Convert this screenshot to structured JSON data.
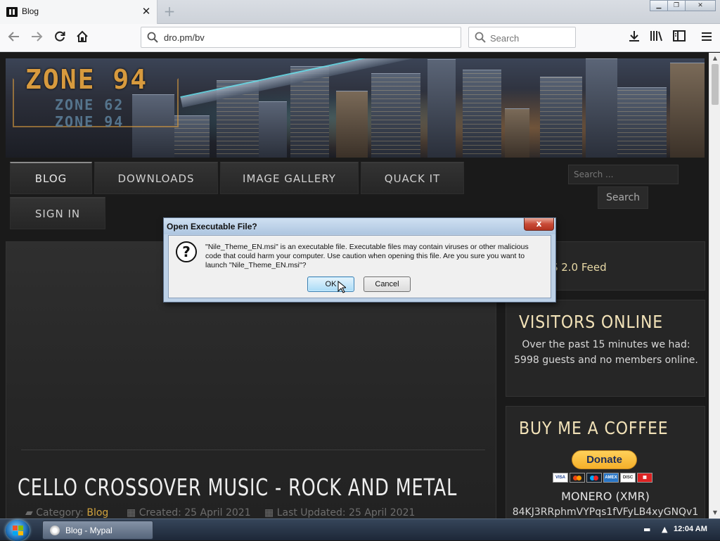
{
  "browser": {
    "tab_title": "Blog",
    "tab_close": "✕",
    "new_tab": "+",
    "url": "dro.pm/bv",
    "search_placeholder": "Search"
  },
  "site": {
    "logo_main": "ZONE 94",
    "logo_sub1": "ZONE 62",
    "logo_sub2": "ZONE 94",
    "menu": [
      "BLOG",
      "DOWNLOADS",
      "IMAGE GALLERY",
      "QUACK IT",
      "SIGN IN"
    ],
    "search_placeholder": "Search ...",
    "search_button": "Search",
    "rss_text": "e RSS 2.0 Feed",
    "visitors_title": "VISITORS ONLINE",
    "visitors_text": "Over the past 15 minutes we had: 5998 guests and no members online.",
    "coffee_title": "BUY ME A COFFEE",
    "donate_label": "Donate",
    "monero_label": "MONERO (XMR)",
    "wallet": "84KJ3RRphmVYPqs1fVFyLB4xyGNQv1",
    "article_title": "CELLO CROSSOVER MUSIC - ROCK AND METAL",
    "meta_category_label": "Category:",
    "meta_category": "Blog",
    "meta_created": "Created: 25 April 2021",
    "meta_updated": "Last Updated: 25 April 2021"
  },
  "dialog": {
    "title": "Open Executable File?",
    "close": "x",
    "message": "\"Nile_Theme_EN.msi\" is an executable file. Executable files may contain viruses or other malicious code that could harm your computer. Use caution when opening this file. Are you sure you want to launch \"Nile_Theme_EN.msi\"?",
    "ok": "OK",
    "cancel": "Cancel"
  },
  "taskbar": {
    "task_label": "Blog - Mypal",
    "clock": "12:04 AM"
  },
  "colors": {
    "accent_gold": "#d0a23e",
    "dialog_frame": "#bcd0e6",
    "page_bg": "#1a1a1a"
  }
}
